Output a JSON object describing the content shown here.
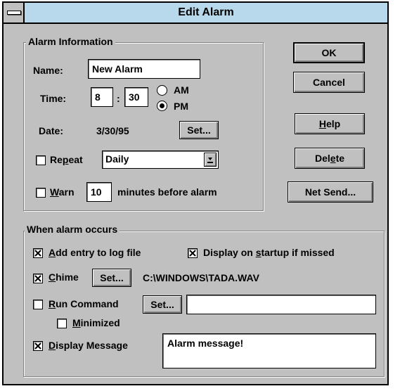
{
  "window": {
    "title": "Edit Alarm"
  },
  "alarm_info": {
    "group_label": "Alarm Information",
    "name_label": "Name:",
    "name_value": "New Alarm",
    "time_label": "Time:",
    "hour": "8",
    "colon": ":",
    "minute": "30",
    "am_label": "AM",
    "pm_label": "PM",
    "pm_selected": true,
    "date_label": "Date:",
    "date_value": "3/30/95",
    "date_set_label": "Set...",
    "repeat_label_pre": "Re",
    "repeat_label_u": "p",
    "repeat_label_post": "eat",
    "repeat_checked": false,
    "repeat_value": "Daily",
    "warn_label_u": "W",
    "warn_label_post": "arn",
    "warn_checked": false,
    "warn_minutes": "10",
    "warn_suffix": "minutes before alarm"
  },
  "buttons": {
    "ok": "OK",
    "cancel": "Cancel",
    "help_u": "H",
    "help_post": "elp",
    "delete_pre": "Del",
    "delete_u": "e",
    "delete_post": "te",
    "net_send": "Net Send..."
  },
  "when_occurs": {
    "group_label": "When alarm occurs",
    "log_u": "A",
    "log_post": "dd entry to log file",
    "log_checked": true,
    "startup_pre": "Display on ",
    "startup_u": "s",
    "startup_post": "tartup if missed",
    "startup_checked": true,
    "chime_u": "C",
    "chime_post": "hime",
    "chime_checked": true,
    "chime_set_label": "Set...",
    "chime_file": "C:\\WINDOWS\\TADA.WAV",
    "run_u": "R",
    "run_post": "un Command",
    "run_checked": false,
    "run_set_label": "Set...",
    "run_value": "",
    "min_u": "M",
    "min_post": "inimized",
    "min_checked": false,
    "msg_u": "D",
    "msg_post": "isplay Message",
    "msg_checked": true,
    "msg_value": "Alarm message!"
  },
  "icons": {
    "system_menu": "system-menu-icon",
    "dropdown": "dropdown-arrow-icon",
    "check": "check-x-icon"
  }
}
